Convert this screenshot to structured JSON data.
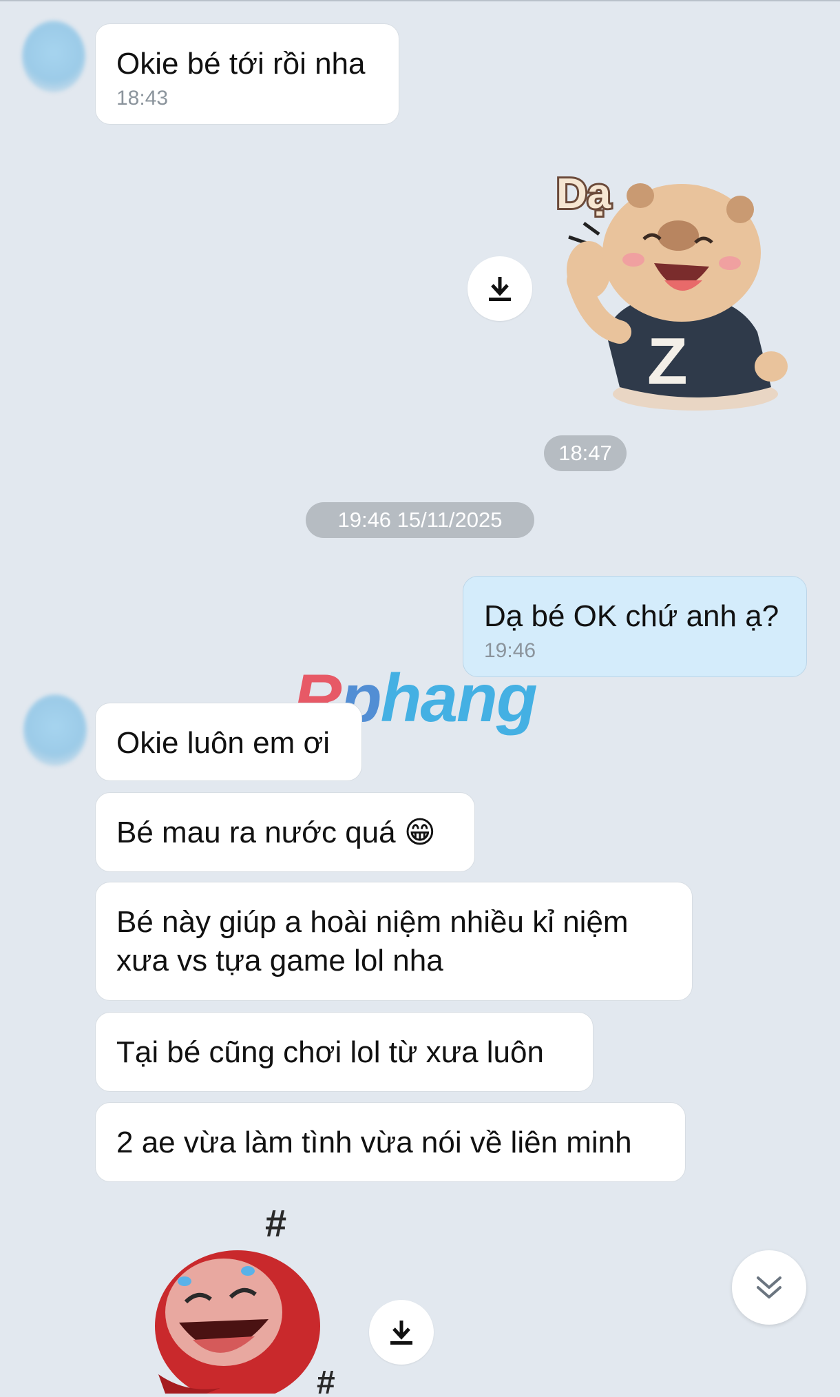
{
  "messages": {
    "m1": {
      "text": "Okie bé tới rồi nha",
      "time": "18:43"
    },
    "sticker_time": "18:47",
    "date_separator": "19:46 15/11/2025",
    "m2": {
      "text": "Dạ bé OK chứ anh ạ?",
      "time": "19:46"
    },
    "m3": {
      "text": "Okie luôn em ơi"
    },
    "m4": {
      "text": "Bé mau ra nước quá 😁"
    },
    "m5": {
      "line1": "Bé này giúp a hoài niệm nhiều kỉ niệm",
      "line2": "xưa vs tựa game lol nha"
    },
    "m6": {
      "text": "Tại bé cũng chơi lol từ xưa luôn"
    },
    "m7": {
      "text": "2 ae vừa làm tình vừa nói về liên minh"
    }
  },
  "stickers": {
    "capybara": {
      "caption": "Dạ",
      "shirt_letter": "Z"
    },
    "angry": {
      "symbol": "#"
    }
  },
  "watermark": {
    "part1": "R",
    "part2": "p",
    "part3": "hang"
  },
  "icons": {
    "download": "download-icon",
    "scroll_down": "double-chevron-down-icon"
  }
}
